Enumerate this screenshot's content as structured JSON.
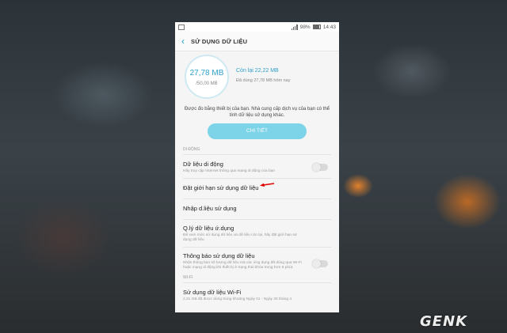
{
  "status_bar": {
    "battery": "98%",
    "time": "14:43"
  },
  "app_bar": {
    "title": "SỬ DỤNG DỮ LIỆU"
  },
  "usage": {
    "used": "27,78 MB",
    "limit": "/50,00 MB",
    "remaining": "Còn lại 22,22 MB",
    "used_today": "Đã dùng 27,78 MB  hôm nay"
  },
  "description": "Được đo bằng thiết bị của bạn. Nhà cung cấp dịch vụ của bạn có thể tính dữ liệu sử dụng khác.",
  "details_button": "CHI TIẾT",
  "mobile_section": {
    "label": "DI ĐỘNG",
    "items": [
      {
        "title": "Dữ liệu di động",
        "subtitle": "Hãy truy cập Internet thông qua mạng di động của bạn",
        "toggle": false
      },
      {
        "title": "Đặt giới hạn sử dụng dữ liệu"
      },
      {
        "title": "Nhập d.liệu sử dụng"
      },
      {
        "title": "Q.lý dữ liệu ứ.dụng",
        "subtitle": "Để xem mức sử dụng dữ liệu và dữ liệu còn lại, hãy đặt giới hạn sử dụng dữ liệu"
      },
      {
        "title": "Thông báo sử dụng dữ liệu",
        "subtitle": "Nhận thông báo số lượng dữ liệu mà các ứng dụng đã dùng qua Wi-Fi hoặc mạng di động khi thiết bị ở trạng thái khóa trong hơn 5 phút.",
        "toggle": false
      }
    ]
  },
  "wifi_section": {
    "label": "WI-FI",
    "items": [
      {
        "title": "Sử dụng dữ liệu Wi-Fi",
        "subtitle": "2,31 GB đã được dùng trong khoảng Ngày 01 - Ngày 26 tháng 4"
      }
    ]
  },
  "watermark": "GENK",
  "colors": {
    "accent": "#2ea0c8",
    "button": "#7dd3e8",
    "arrow": "#e00000"
  }
}
